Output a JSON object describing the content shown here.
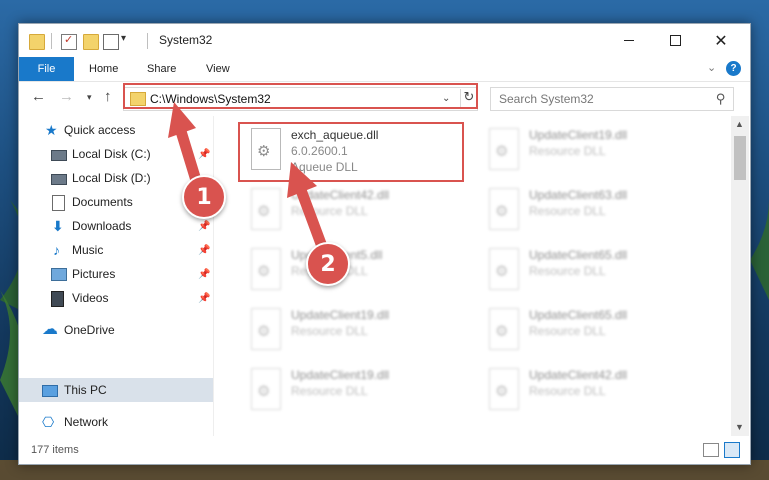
{
  "window": {
    "title": "System32",
    "controls": {
      "minimize": "",
      "maximize": "",
      "close": "✕"
    }
  },
  "ribbon": {
    "tabs": [
      "File",
      "Home",
      "Share",
      "View"
    ],
    "help": "?"
  },
  "nav": {
    "address": "C:\\Windows\\System32",
    "search_placeholder": "Search System32"
  },
  "sidebar": {
    "items": [
      {
        "label": "Quick access",
        "icon": "star-icon",
        "pinned": false
      },
      {
        "label": "Local Disk (C:)",
        "icon": "disk-icon",
        "pinned": true
      },
      {
        "label": "Local Disk (D:)",
        "icon": "disk-icon",
        "pinned": false
      },
      {
        "label": "Documents",
        "icon": "document-icon",
        "pinned": true
      },
      {
        "label": "Downloads",
        "icon": "download-icon",
        "pinned": true
      },
      {
        "label": "Music",
        "icon": "music-icon",
        "pinned": true
      },
      {
        "label": "Pictures",
        "icon": "pictures-icon",
        "pinned": true
      },
      {
        "label": "Videos",
        "icon": "videos-icon",
        "pinned": true
      },
      {
        "label": "OneDrive",
        "icon": "cloud-icon",
        "pinned": false
      },
      {
        "label": "This PC",
        "icon": "pc-icon",
        "pinned": false,
        "selected": true
      },
      {
        "label": "Network",
        "icon": "network-icon",
        "pinned": false
      }
    ]
  },
  "files": [
    {
      "name": "exch_aqueue.dll",
      "version": "6.0.2600.1",
      "desc": "Aqueue DLL"
    },
    {
      "name": "UpdateClient19.dll",
      "version": "",
      "desc": "Resource DLL"
    },
    {
      "name": "UpdateClient42.dll",
      "version": "",
      "desc": "Resource DLL"
    },
    {
      "name": "UpdateClient63.dll",
      "version": "",
      "desc": "Resource DLL"
    },
    {
      "name": "UpdateClient5.dll",
      "version": "",
      "desc": "Resource DLL"
    },
    {
      "name": "UpdateClient65.dll",
      "version": "",
      "desc": "Resource DLL"
    },
    {
      "name": "UpdateClient19.dll",
      "version": "",
      "desc": "Resource DLL"
    },
    {
      "name": "UpdateClient65.dll",
      "version": "",
      "desc": "Resource DLL"
    },
    {
      "name": "UpdateClient19.dll",
      "version": "",
      "desc": "Resource DLL"
    },
    {
      "name": "UpdateClient42.dll",
      "version": "",
      "desc": "Resource DLL"
    }
  ],
  "status": {
    "items_count": "177 items"
  },
  "annotations": {
    "step1": "1",
    "step2": "2"
  },
  "colors": {
    "accent": "#1979ca",
    "annotation": "#d9534f"
  }
}
